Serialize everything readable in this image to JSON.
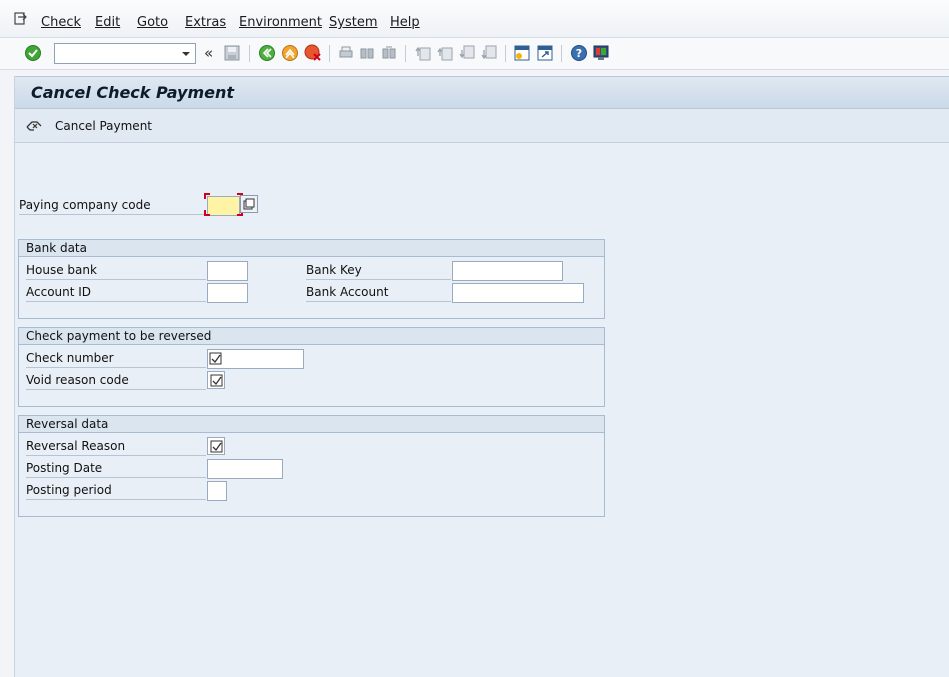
{
  "menu": {
    "items": [
      {
        "label": "Check"
      },
      {
        "label": "Edit"
      },
      {
        "label": "Goto"
      },
      {
        "label": "Extras"
      },
      {
        "label": "Environment"
      },
      {
        "label": "System"
      },
      {
        "label": "Help"
      }
    ]
  },
  "toolbar": {
    "command_field_value": "",
    "collapse_glyph": "«"
  },
  "title": "Cancel Check Payment",
  "app_toolbar": {
    "cancel_payment_label": "Cancel Payment"
  },
  "form": {
    "paying_company_code": {
      "label": "Paying company code",
      "value": ""
    },
    "bank_data": {
      "title": "Bank data",
      "house_bank": {
        "label": "House bank",
        "value": ""
      },
      "account_id": {
        "label": "Account ID",
        "value": ""
      },
      "bank_key": {
        "label": "Bank Key",
        "value": ""
      },
      "bank_account": {
        "label": "Bank Account",
        "value": ""
      }
    },
    "check_payment": {
      "title": "Check payment to be reversed",
      "check_number": {
        "label": "Check number",
        "value": ""
      },
      "void_reason_code": {
        "label": "Void reason code",
        "value": ""
      }
    },
    "reversal_data": {
      "title": "Reversal data",
      "reversal_reason": {
        "label": "Reversal Reason",
        "value": ""
      },
      "posting_date": {
        "label": "Posting Date",
        "value": ""
      },
      "posting_period": {
        "label": "Posting period",
        "value": ""
      }
    }
  },
  "colors": {
    "accent": "#d0021b",
    "required_bg": "#fff3a6"
  }
}
